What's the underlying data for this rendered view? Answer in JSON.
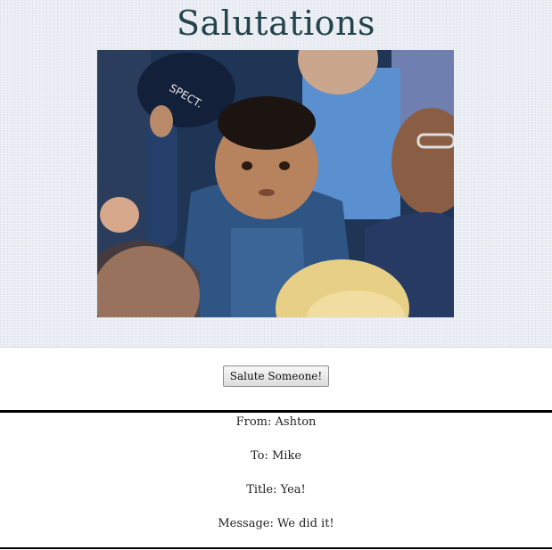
{
  "page": {
    "title": "Salutations",
    "photo_alt": "crowd photo",
    "salute_button_label": "Salute Someone!"
  },
  "salutation": {
    "from_label": "From:",
    "from": "Ashton",
    "to_label": "To:",
    "to": "Mike",
    "title_label": "Title:",
    "title": "Yea!",
    "message_label": "Message:",
    "message": "We did it!"
  },
  "colors": {
    "title": "#24434a",
    "header_bg": "#e9edf3",
    "rule": "#000000"
  }
}
